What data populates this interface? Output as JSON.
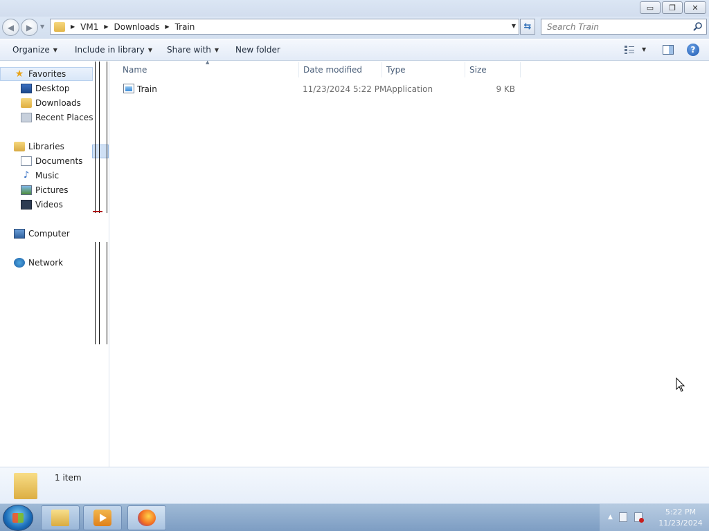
{
  "window": {
    "minimize_glyph": "▭",
    "restore_glyph": "❐",
    "close_glyph": "✕"
  },
  "address_bar": {
    "breadcrumbs": [
      "VM1",
      "Downloads",
      "Train"
    ]
  },
  "search": {
    "placeholder": "Search Train"
  },
  "toolbar": {
    "organize": "Organize",
    "include_in_library": "Include in library",
    "share_with": "Share with",
    "new_folder": "New folder"
  },
  "nav_pane": {
    "favorites": {
      "label": "Favorites",
      "items": [
        "Desktop",
        "Downloads",
        "Recent Places"
      ]
    },
    "libraries": {
      "label": "Libraries",
      "items": [
        "Documents",
        "Music",
        "Pictures",
        "Videos"
      ]
    },
    "computer": "Computer",
    "network": "Network"
  },
  "columns": {
    "name": "Name",
    "date_modified": "Date modified",
    "type": "Type",
    "size": "Size"
  },
  "files": [
    {
      "name": "Train",
      "date_modified": "11/23/2024 5:22 PM",
      "type": "Application",
      "size": "9 KB",
      "icon": "application-icon"
    }
  ],
  "details": {
    "item_count": "1 item"
  },
  "taskbar": {
    "clock_time": "5:22 PM",
    "clock_date": "11/23/2024"
  },
  "colors": {
    "accent": "#2f6fb8",
    "header_text": "#4c607a",
    "secondary_text": "#6d6d6d"
  }
}
